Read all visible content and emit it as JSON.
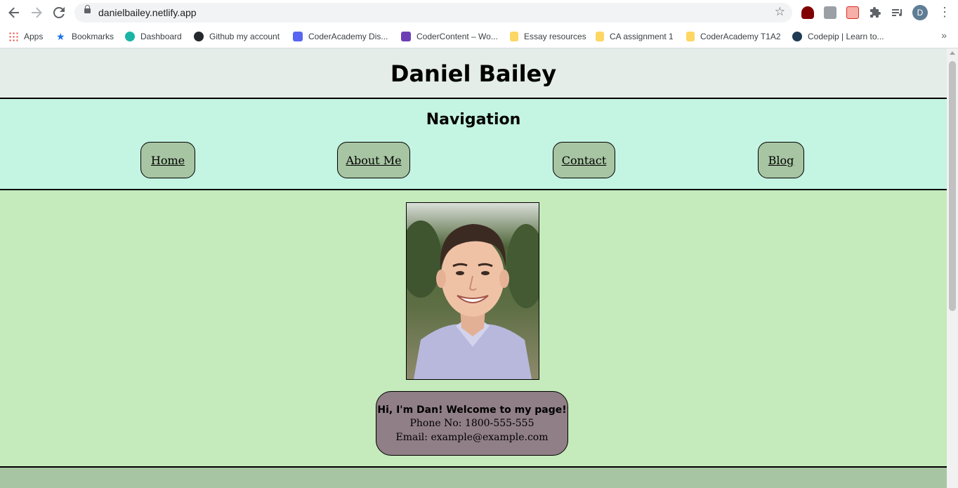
{
  "browser": {
    "url": "danielbailey.netlify.app",
    "avatar_letter": "D",
    "bookmarks": [
      {
        "label": "Apps",
        "color": "#e94235"
      },
      {
        "label": "Bookmarks",
        "color": "#1a73e8"
      },
      {
        "label": "Dashboard",
        "color": "#1bb4a6"
      },
      {
        "label": "Github my account",
        "color": "#24292e"
      },
      {
        "label": "CoderAcademy Dis...",
        "color": "#5865f2"
      },
      {
        "label": "CoderContent – Wo...",
        "color": "#6c3fb5"
      },
      {
        "label": "Essay resources",
        "color": "#fdd663"
      },
      {
        "label": "CA assignment 1",
        "color": "#fdd663"
      },
      {
        "label": "CoderAcademy T1A2",
        "color": "#fdd663"
      },
      {
        "label": "Codepip | Learn to...",
        "color": "#1f3b54"
      }
    ],
    "more_glyph": "»"
  },
  "site": {
    "title": "Daniel Bailey",
    "nav_heading": "Navigation",
    "nav_links": [
      "Home",
      "About Me",
      "Contact",
      "Blog"
    ],
    "intro_bold": "Hi, I'm Dan! Welcome to my page!",
    "phone": "Phone No: 1800-555-555",
    "email": "Email: example@example.com",
    "next_heading_partial": "..."
  },
  "colors": {
    "header_bg": "#e4ede8",
    "nav_bg": "#c4f4e2",
    "nav_button_bg": "#a7c5a3",
    "main_bg": "#c5eabb",
    "info_box_bg": "#907f86"
  }
}
